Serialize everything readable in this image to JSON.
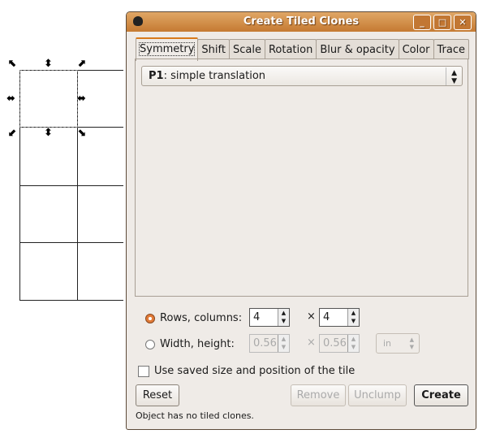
{
  "window": {
    "title": "Create Tiled Clones",
    "minimize": "_",
    "maximize": "□",
    "close": "✕"
  },
  "tabs": [
    {
      "label": "Symmetry",
      "active": true
    },
    {
      "label": "Shift"
    },
    {
      "label": "Scale"
    },
    {
      "label": "Rotation"
    },
    {
      "label": "Blur & opacity"
    },
    {
      "label": "Color"
    },
    {
      "label": "Trace"
    }
  ],
  "symmetry": {
    "code": "P1",
    "name": ": simple translation"
  },
  "rows_columns": {
    "label": "Rows, columns:",
    "selected": true,
    "rows": "4",
    "columns": "4"
  },
  "width_height": {
    "label": "Width, height:",
    "selected": false,
    "width": "0.56",
    "height": "0.56",
    "unit": "in"
  },
  "times": "×",
  "use_saved": {
    "label": "Use saved size and position of the tile",
    "checked": false
  },
  "buttons": {
    "reset": "Reset",
    "remove": "Remove",
    "unclump": "Unclump",
    "create": "Create"
  },
  "status": "Object has no tiled clones.",
  "colors": {
    "titlebar": "#d08a45",
    "active_radio": "#e27a36",
    "tab_highlight": "#d97a1b"
  }
}
